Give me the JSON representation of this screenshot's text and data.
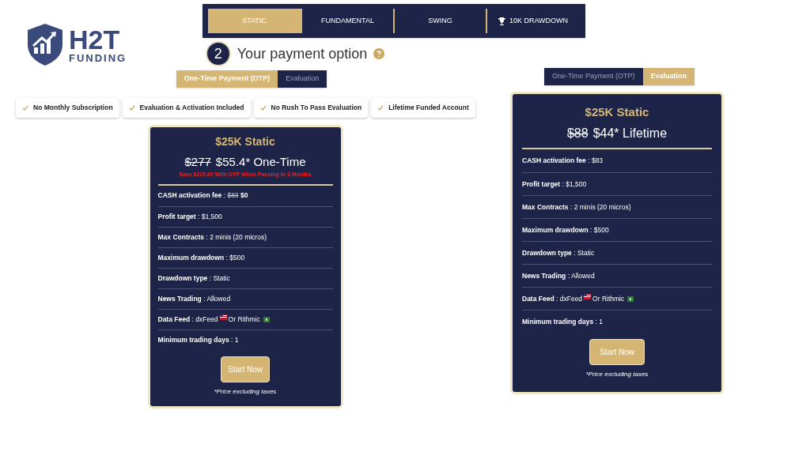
{
  "logo": {
    "line1": "H2T",
    "line2": "FUNDING"
  },
  "plan_tabs": [
    {
      "label": "STATIC",
      "selected": true
    },
    {
      "label": "FUNDAMENTAL",
      "selected": false
    },
    {
      "label": "SWING",
      "selected": false
    },
    {
      "label": "10K DRAWDOWN",
      "selected": false
    }
  ],
  "detail_separator": ":",
  "heading": {
    "step": "2",
    "title": "Your payment option"
  },
  "panels": [
    {
      "toggle": [
        {
          "label": "One-Time Payment (OTP)",
          "selected": true
        },
        {
          "label": "Evaluation",
          "selected": false
        }
      ],
      "features": [
        "No Monthly Subscription",
        "Evaluation & Activation Included",
        "No Rush To Pass Evaluation",
        "Lifetime Funded Account"
      ],
      "card": {
        "title": "$25K Static",
        "old_price": "$277",
        "price": "$55.4* One-Time",
        "note": "Save $225.60 With OTP When Passing in 3 Months",
        "rows": [
          {
            "kind": "strike",
            "label": "CASH activation fee",
            "old": "$83",
            "value": "$0"
          },
          {
            "kind": "text",
            "label": "Profit target",
            "value": "$1,500"
          },
          {
            "kind": "text",
            "label": "Max Contracts",
            "value": "2 minis (20 micros)"
          },
          {
            "kind": "text",
            "label": "Maximum drawdown",
            "value": "$500"
          },
          {
            "kind": "text",
            "label": "Drawdown type",
            "value": "Static"
          },
          {
            "kind": "text",
            "label": "News Trading",
            "value": "Allowed"
          },
          {
            "kind": "feed",
            "label": "Data Feed",
            "value": "dxFeed",
            "value2": "Or Rithmic"
          },
          {
            "kind": "text",
            "label": "Minimum trading days",
            "value": "1"
          }
        ],
        "button": "Start Now",
        "footnote": "*Price excluding taxes"
      }
    },
    {
      "toggle": [
        {
          "label": "One-Time Payment (OTP)",
          "selected": false
        },
        {
          "label": "Evaluation",
          "selected": true
        }
      ],
      "card": {
        "title": "$25K Static",
        "old_price": "$88",
        "price": "$44* Lifetime",
        "rows": [
          {
            "kind": "text",
            "label": "CASH activation fee",
            "value": "$83"
          },
          {
            "kind": "text",
            "label": "Profit target",
            "value": "$1,500"
          },
          {
            "kind": "text",
            "label": "Max Contracts",
            "value": "2 minis (20 micros)"
          },
          {
            "kind": "text",
            "label": "Maximum drawdown",
            "value": "$500"
          },
          {
            "kind": "text",
            "label": "Drawdown type",
            "value": "Static"
          },
          {
            "kind": "text",
            "label": "News Trading",
            "value": "Allowed"
          },
          {
            "kind": "feed",
            "label": "Data Feed",
            "value": "dxFeed",
            "value2": "Or Rithmic"
          },
          {
            "kind": "text",
            "label": "Minimum trading days",
            "value": "1"
          }
        ],
        "button": "Start Now",
        "footnote": "*Price excluding taxes"
      }
    }
  ]
}
